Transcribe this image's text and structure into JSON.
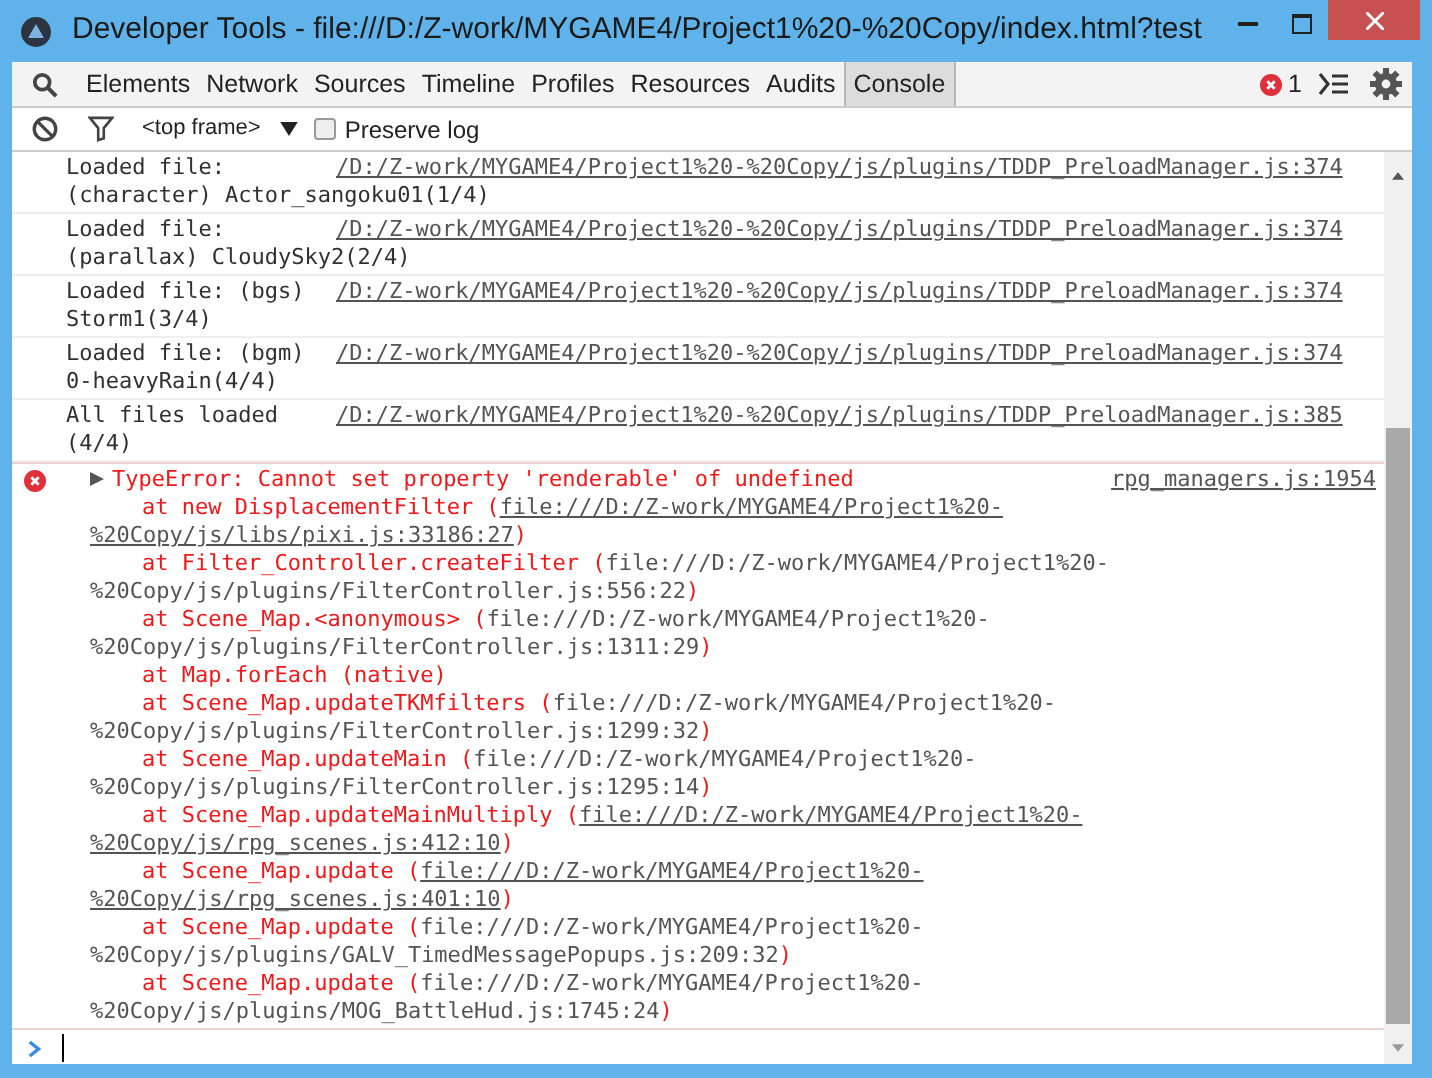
{
  "window": {
    "title": "Developer Tools - file:///D:/Z-work/MYGAME4/Project1%20-%20Copy/index.html?test"
  },
  "tabs": [
    {
      "label": "Elements",
      "selected": false
    },
    {
      "label": "Network",
      "selected": false
    },
    {
      "label": "Sources",
      "selected": false
    },
    {
      "label": "Timeline",
      "selected": false
    },
    {
      "label": "Profiles",
      "selected": false
    },
    {
      "label": "Resources",
      "selected": false
    },
    {
      "label": "Audits",
      "selected": false
    },
    {
      "label": "Console",
      "selected": true
    }
  ],
  "error_count": "1",
  "console_toolbar": {
    "frame": "<top frame>",
    "preserve_log": {
      "label": "Preserve log",
      "checked": false
    }
  },
  "logs": [
    {
      "message": [
        "Loaded file:",
        "(character) Actor_sangoku01(1/4)"
      ],
      "source": "/D:/Z-work/MYGAME4/Project1%20-%20Copy/js/plugins/TDDP_PreloadManager.js:374"
    },
    {
      "message": [
        "Loaded file:",
        "(parallax) CloudySky2(2/4)"
      ],
      "source": "/D:/Z-work/MYGAME4/Project1%20-%20Copy/js/plugins/TDDP_PreloadManager.js:374"
    },
    {
      "message": [
        "Loaded file: (bgs)",
        "Storm1(3/4)"
      ],
      "source": "/D:/Z-work/MYGAME4/Project1%20-%20Copy/js/plugins/TDDP_PreloadManager.js:374"
    },
    {
      "message": [
        "Loaded file: (bgm)",
        "0-heavyRain(4/4)"
      ],
      "source": "/D:/Z-work/MYGAME4/Project1%20-%20Copy/js/plugins/TDDP_PreloadManager.js:374"
    },
    {
      "message": [
        "All files loaded",
        "(4/4)"
      ],
      "source": "/D:/Z-work/MYGAME4/Project1%20-%20Copy/js/plugins/TDDP_PreloadManager.js:385"
    }
  ],
  "error": {
    "expanded": false,
    "message": "TypeError: Cannot set property 'renderable' of undefined",
    "source": "rpg_managers.js:1954",
    "trace": [
      {
        "call": "at new DisplacementFilter (",
        "location": [
          "file:///D:/Z-work/MYGAME4/Project1%20-",
          "%20Copy/js/libs/pixi.js:33186:27"
        ],
        "close": ")",
        "linked": true
      },
      {
        "call": "at Filter_Controller.createFilter (",
        "location": [
          "file:///D:/Z-work/MYGAME4/Project1%20-",
          "%20Copy/js/plugins/FilterController.js:556:22"
        ],
        "close": ")",
        "linked": false
      },
      {
        "call": "at Scene_Map.<anonymous> (",
        "location": [
          "file:///D:/Z-work/MYGAME4/Project1%20-",
          "%20Copy/js/plugins/FilterController.js:1311:29"
        ],
        "close": ")",
        "linked": false
      },
      {
        "call": "at Map.forEach (native)"
      },
      {
        "call": "at Scene_Map.updateTKMfilters (",
        "location": [
          "file:///D:/Z-work/MYGAME4/Project1%20-",
          "%20Copy/js/plugins/FilterController.js:1299:32"
        ],
        "close": ")",
        "linked": false
      },
      {
        "call": "at Scene_Map.updateMain (",
        "location": [
          "file:///D:/Z-work/MYGAME4/Project1%20-",
          "%20Copy/js/plugins/FilterController.js:1295:14"
        ],
        "close": ")",
        "linked": false
      },
      {
        "call": "at Scene_Map.updateMainMultiply (",
        "location": [
          "file:///D:/Z-work/MYGAME4/Project1%20-",
          "%20Copy/js/rpg_scenes.js:412:10"
        ],
        "close": ")",
        "linked": true
      },
      {
        "call": "at Scene_Map.update (",
        "location": [
          "file:///D:/Z-work/MYGAME4/Project1%20-",
          "%20Copy/js/rpg_scenes.js:401:10"
        ],
        "close": ")",
        "linked": true
      },
      {
        "call": "at Scene_Map.update (",
        "location": [
          "file:///D:/Z-work/MYGAME4/Project1%20-",
          "%20Copy/js/plugins/GALV_TimedMessagePopups.js:209:32"
        ],
        "close": ")",
        "linked": false
      },
      {
        "call": "at Scene_Map.update (",
        "location": [
          "file:///D:/Z-work/MYGAME4/Project1%20-",
          "%20Copy/js/plugins/MOG_BattleHud.js:1745:24"
        ],
        "close": ")",
        "linked": false
      }
    ]
  }
}
